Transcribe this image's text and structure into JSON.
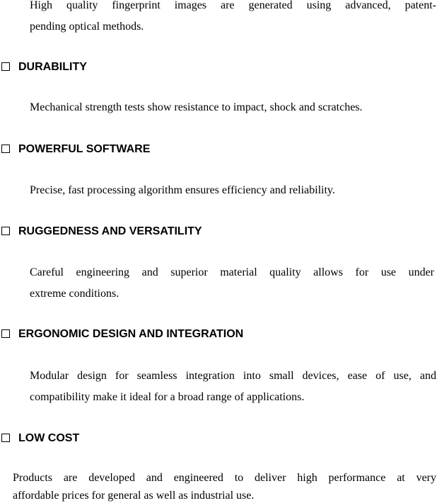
{
  "sections": [
    {
      "heading": null,
      "lines": [
        "High quality fingerprint images  are generated using advanced, patent-",
        "pending optical methods."
      ]
    },
    {
      "heading": "DURABILITY",
      "lines": [
        "Mechanical strength tests show resistance to impact, shock and scratches."
      ]
    },
    {
      "heading": "POWERFUL SOFTWARE",
      "lines": [
        "Precise, fast processing algorithm ensures efficiency and reliability."
      ]
    },
    {
      "heading": "RUGGEDNESS AND VERSATILITY",
      "lines": [
        "Careful engineering and  superior material quality allows for use under",
        "extreme conditions."
      ]
    },
    {
      "heading": "ERGONOMIC DESIGN AND INTEGRATION",
      "lines": [
        "Modular design for seamless integration into small devices, ease of use, and",
        "compatibility make it ideal for a broad range of applications."
      ]
    },
    {
      "heading": "LOW COST",
      "lines": [
        "Products are developed and engineered to deliver high performance at very",
        "affordable prices for general as well as industrial use."
      ]
    }
  ]
}
